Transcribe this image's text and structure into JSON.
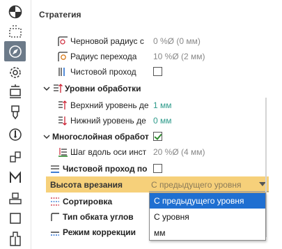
{
  "section_title": "Стратегия",
  "rows": {
    "rough_radius": {
      "label": "Черновой радиус с",
      "value": "0 %Ø (0 мм)"
    },
    "transition_radius": {
      "label": "Радиус перехода",
      "value": "10 %Ø (2 мм)"
    },
    "finish_pass": {
      "label": "Чистовой проход",
      "checked": false
    },
    "levels_group": {
      "label": "Уровни обработки"
    },
    "top_level": {
      "label": "Верхний уровень де",
      "value": "1 мм"
    },
    "bottom_level": {
      "label": "Нижний уровень де",
      "value": "0 мм"
    },
    "multilayer": {
      "label": "Многослойная обработ",
      "checked": true
    },
    "axis_step": {
      "label": "Шаг вдоль оси инст",
      "value": "20 %Ø (4 мм)"
    },
    "finish_pass_by": {
      "label": "Чистовой проход по",
      "checked": false
    },
    "cut_height": {
      "label": "Высота врезания",
      "value": "С предыдущего уровня"
    },
    "sorting": {
      "label": "Сортировка"
    },
    "rollover_type": {
      "label": "Тип обката углов"
    },
    "correction_mode": {
      "label": "Режим коррекции"
    }
  },
  "dropdown": {
    "options": [
      "С предыдущего уровня",
      "С уровня",
      "мм"
    ],
    "selected": "С предыдущего уровня"
  },
  "colors": {
    "highlight": "#f6d07a",
    "selection": "#1f6fd1",
    "value_teal": "#2d9a8a",
    "active_tool": "#6c7a89"
  },
  "toolbar": {
    "icons": [
      "pie-chart-icon",
      "dashed-select-icon",
      "strategy-compass-icon",
      "gear-icon",
      "fixture-icon",
      "tool-icon",
      "target-icon",
      "multi-part-icon",
      "m-letter-icon",
      "stamp-icon",
      "square-icon",
      "tower-icon"
    ]
  }
}
